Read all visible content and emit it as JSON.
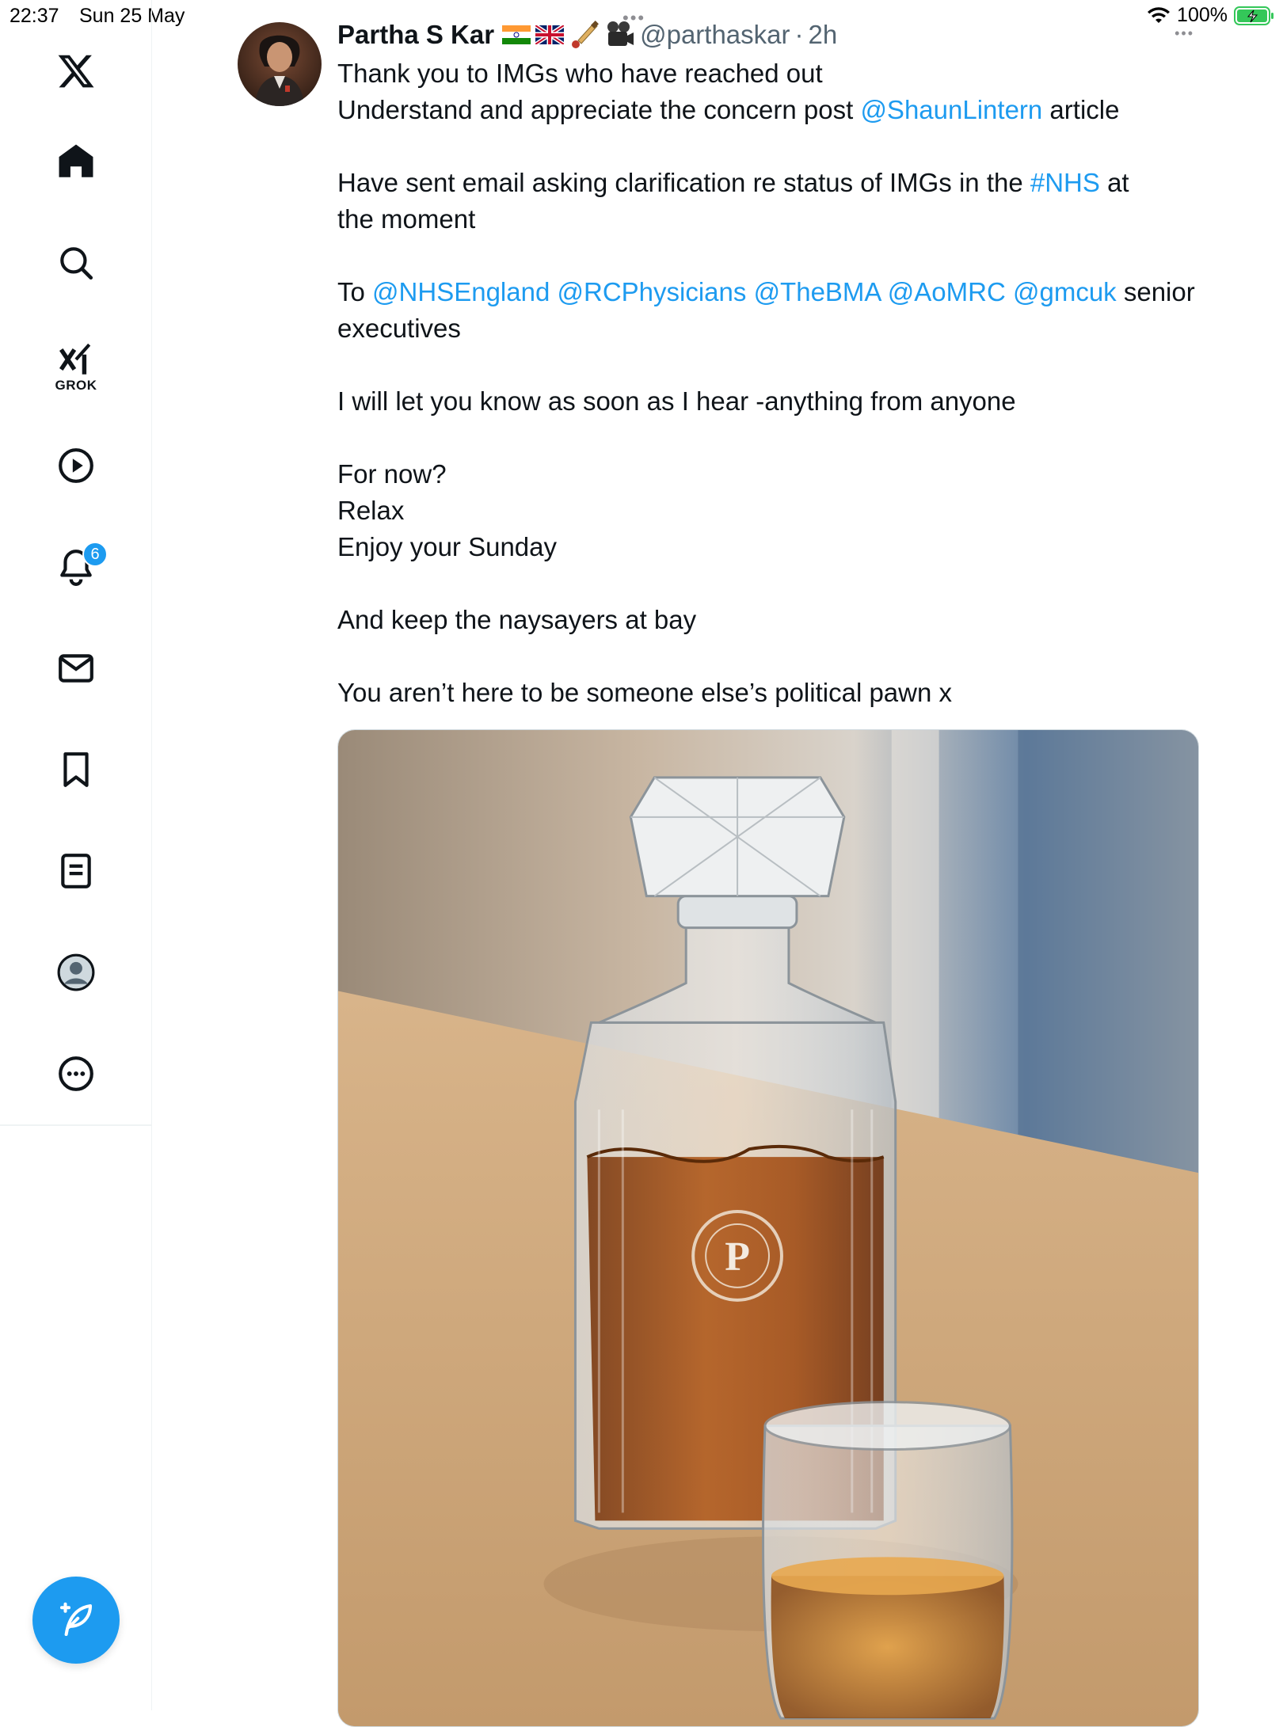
{
  "status_bar": {
    "time": "22:37",
    "date": "Sun 25 May",
    "battery": "100%"
  },
  "sidebar": {
    "items": [
      {
        "name": "logo",
        "icon": "x-logo-icon"
      },
      {
        "name": "home",
        "icon": "home-icon"
      },
      {
        "name": "explore",
        "icon": "search-icon"
      },
      {
        "name": "grok",
        "icon": "grok-icon",
        "label": "GROK"
      },
      {
        "name": "video",
        "icon": "play-icon"
      },
      {
        "name": "notifications",
        "icon": "bell-icon",
        "badge": "6"
      },
      {
        "name": "messages",
        "icon": "mail-icon"
      },
      {
        "name": "bookmarks",
        "icon": "bookmark-icon"
      },
      {
        "name": "lists",
        "icon": "list-icon"
      },
      {
        "name": "profile",
        "icon": "profile-icon"
      },
      {
        "name": "more",
        "icon": "more-icon"
      }
    ],
    "compose_icon": "compose-icon"
  },
  "tweet": {
    "author": {
      "display_name": "Partha S Kar",
      "name_emojis": [
        "india-flag-icon",
        "uk-flag-icon",
        "cricket-icon",
        "camera-icon"
      ],
      "handle": "@parthaskar",
      "separator": "·",
      "time": "2h"
    },
    "lines": {
      "l1": "Thank you to IMGs who have reached out",
      "l2_a": "Understand and appreciate the concern post ",
      "l2_link": "@ShaunLintern",
      "l2_b": " article",
      "l3_a": "Have sent email asking clarification re status of IMGs in the ",
      "l3_link": "#NHS",
      "l3_b": " at",
      "l4": "the moment",
      "l5_a": "To ",
      "l5_links": [
        "@NHSEngland",
        "@RCPhysicians",
        "@TheBMA",
        "@AoMRC",
        "@gmcuk"
      ],
      "l5_b": " senior",
      "l6": "executives",
      "l7": "I will let you know as soon as I hear -anything from anyone",
      "l8": "For now?",
      "l9": "Relax",
      "l10": "Enjoy your Sunday",
      "l11": "And keep the naysayers at bay",
      "l12": "You aren’t here to be someone else’s political pawn x"
    },
    "media": {
      "engraving_letter": "P"
    }
  },
  "colors": {
    "accent": "#1d9bf0",
    "text": "#0f1419",
    "secondary": "#536471",
    "battery_green": "#34c759"
  }
}
